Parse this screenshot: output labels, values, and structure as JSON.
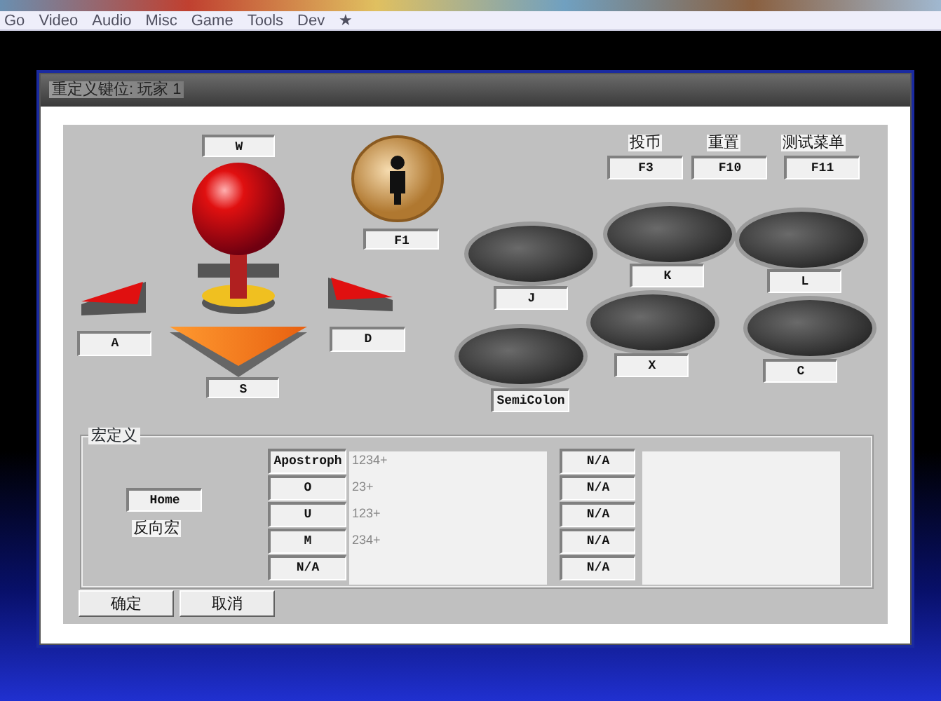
{
  "menu": [
    {
      "label": "Go"
    },
    {
      "label": "Video"
    },
    {
      "label": "Audio"
    },
    {
      "label": "Misc"
    },
    {
      "label": "Game"
    },
    {
      "label": "Tools"
    },
    {
      "label": "Dev"
    },
    {
      "label": "★"
    }
  ],
  "dialog": {
    "title": "重定义键位: 玩家 1",
    "joystick": {
      "up": "W",
      "left": "A",
      "right": "D",
      "down": "S"
    },
    "coin_key": "F1",
    "function_keys": [
      {
        "label": "投币",
        "key": "F3"
      },
      {
        "label": "重置",
        "key": "F10"
      },
      {
        "label": "测试菜单",
        "key": "F11"
      }
    ],
    "buttons": [
      {
        "key": "J"
      },
      {
        "key": "K"
      },
      {
        "key": "L"
      },
      {
        "key": "X"
      },
      {
        "key": "C"
      },
      {
        "key": "SemiColon"
      }
    ],
    "macro": {
      "legend": "宏定义",
      "home_key": "Home",
      "reverse_label": "反向宏",
      "rows": [
        {
          "key": "Apostroph",
          "sequence": "1234+"
        },
        {
          "key": "O",
          "sequence": "23+"
        },
        {
          "key": "U",
          "sequence": "123+"
        },
        {
          "key": "M",
          "sequence": "234+"
        },
        {
          "key": "N/A"
        }
      ],
      "second_keys": [
        "N/A",
        "N/A",
        "N/A",
        "N/A",
        "N/A"
      ]
    },
    "actions": [
      "确定",
      "取消"
    ]
  }
}
